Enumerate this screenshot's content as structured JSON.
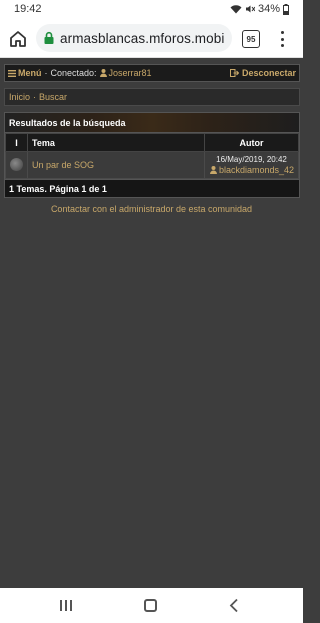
{
  "status_bar": {
    "time": "19:42",
    "battery": "34%"
  },
  "browser": {
    "url": "armasblancas.mforos.mobi",
    "tab_count": "95"
  },
  "topbar": {
    "menu_label": "Menú",
    "separator": "·",
    "connected_label": "Conectado:",
    "username": "Joserrar81",
    "disconnect_label": "Desconectar"
  },
  "breadcrumb": {
    "home": "Inicio",
    "separator": "·",
    "current": "Buscar"
  },
  "results": {
    "title": "Resultados de la búsqueda",
    "columns": {
      "icon": "I",
      "topic": "Tema",
      "author": "Autor"
    },
    "rows": [
      {
        "topic": "Un par de SOG",
        "date": "16/May/2019, 20:42",
        "author": "blackdiamonds_42"
      }
    ],
    "footer": "1 Temas. Página 1 de 1"
  },
  "contact_link": "Contactar con el administrador de esta comunidad",
  "colors": {
    "accent": "#c8a86a",
    "background": "#3d3d3d",
    "panel": "#1b1b1b"
  },
  "icons": {
    "menu": "hamburger-icon",
    "user": "user-icon",
    "disconnect": "sign-out-icon",
    "lock": "lock-icon",
    "home": "home-icon"
  }
}
